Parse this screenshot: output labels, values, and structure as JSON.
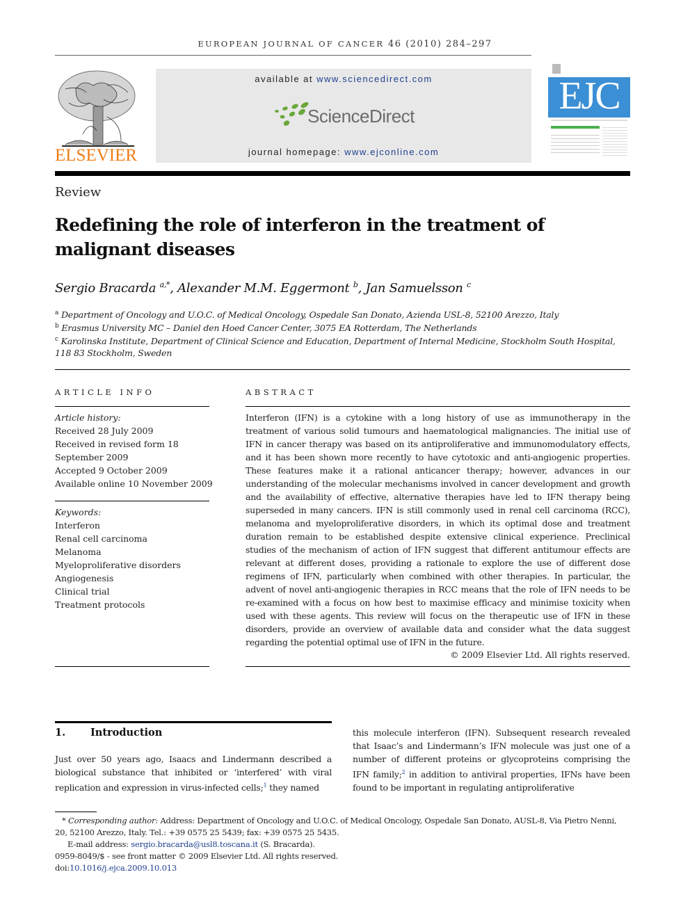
{
  "header": {
    "journal_name": "EUROPEAN JOURNAL OF CANCER",
    "volume_info": "46 (2010) 284–297",
    "publisher_wordmark": "ELSEVIER",
    "available_at_prefix": "available at ",
    "available_at_link": "www.sciencedirect.com",
    "sciencedirect_wordmark": "ScienceDirect",
    "homepage_prefix": "journal homepage: ",
    "homepage_link": "www.ejconline.com",
    "cover_title": "EJC",
    "colors": {
      "elsevier_orange": "#ef7d15",
      "sciencedirect_green": "#6aa83a",
      "ejc_blue": "#3b8fd4",
      "link_blue": "#1f3f8f"
    }
  },
  "article": {
    "section_type": "Review",
    "title": "Redefining the role of interferon in the treatment of malignant diseases",
    "authors": [
      {
        "name": "Sergio Bracarda",
        "sup": "a,*"
      },
      {
        "name": "Alexander M.M. Eggermont",
        "sup": "b"
      },
      {
        "name": "Jan Samuelsson",
        "sup": "c"
      }
    ],
    "affiliations": [
      {
        "key": "a",
        "text": "Department of Oncology and U.O.C. of Medical Oncology, Ospedale San Donato, Azienda USL-8, 52100 Arezzo, Italy"
      },
      {
        "key": "b",
        "text": "Erasmus University MC – Daniel den Hoed Cancer Center, 3075 EA Rotterdam, The Netherlands"
      },
      {
        "key": "c",
        "text": "Karolinska Institute, Department of Clinical Science and Education, Department of Internal Medicine, Stockholm South Hospital,",
        "text2": "118 83 Stockholm, Sweden"
      }
    ]
  },
  "article_info": {
    "heading": "ARTICLE INFO",
    "history_label": "Article history:",
    "history": [
      "Received 28 July 2009",
      "Received in revised form 18",
      "September 2009",
      "Accepted 9 October 2009",
      "Available online 10 November 2009"
    ],
    "keywords_label": "Keywords:",
    "keywords": [
      "Interferon",
      "Renal cell carcinoma",
      "Melanoma",
      "Myeloproliferative disorders",
      "Angiogenesis",
      "Clinical trial",
      "Treatment protocols"
    ]
  },
  "abstract": {
    "heading": "ABSTRACT",
    "text": "Interferon (IFN) is a cytokine with a long history of use as immunotherapy in the treatment of various solid tumours and haematological malignancies. The initial use of IFN in cancer therapy was based on its antiproliferative and immunomodulatory effects, and it has been shown more recently to have cytotoxic and anti-angiogenic properties. These features make it a rational anticancer therapy; however, advances in our understanding of the molecular mechanisms involved in cancer development and growth and the availability of effective, alternative therapies have led to IFN therapy being superseded in many cancers. IFN is still commonly used in renal cell carcinoma (RCC), melanoma and myeloproliferative disorders, in which its optimal dose and treatment duration remain to be established despite extensive clinical experience. Preclinical studies of the mechanism of action of IFN suggest that different antitumour effects are relevant at different doses, providing a rationale to explore the use of different dose regimens of IFN, particularly when combined with other therapies. In particular, the advent of novel anti-angiogenic therapies in RCC means that the role of IFN needs to be re-examined with a focus on how best to maximise efficacy and minimise toxicity when used with these agents. This review will focus on the therapeutic use of IFN in these disorders, provide an overview of available data and consider what the data suggest regarding the potential optimal use of IFN in the future.",
    "copyright": "© 2009 Elsevier Ltd. All rights reserved."
  },
  "introduction": {
    "number": "1.",
    "heading": "Introduction",
    "col1_a": "Just over 50 years ago, Isaacs and Lindermann described a biological substance that inhibited or ‘interfered’ with viral replication and expression in virus-infected cells;",
    "col1_ref": "1",
    "col1_b": " they named",
    "col2_a": "this molecule interferon (IFN). Subsequent research revealed that Isaac’s and Lindermann’s IFN molecule was just one of a number of different proteins or glycoproteins comprising the IFN family;",
    "col2_ref": "2",
    "col2_b": " in addition to antiviral properties, IFNs have been found to be important in regulating antiproliferative"
  },
  "footnotes": {
    "star": "*",
    "corresponding_label": "Corresponding author:",
    "corresponding_text": " Address: Department of Oncology and U.O.C. of Medical Oncology, Ospedale San Donato, AUSL-8, Via Pietro Nenni, 20, 52100 Arezzo, Italy. Tel.: +39 0575 25 5439; fax: +39 0575 25 5435.",
    "email_label": "E-mail address: ",
    "email": "sergio.bracarda@usl8.toscana.it",
    "email_suffix": " (S. Bracarda).",
    "issn_line": "0959-8049/$ - see front matter © 2009 Elsevier Ltd. All rights reserved.",
    "doi_label": "doi:",
    "doi": "10.1016/j.ejca.2009.10.013"
  }
}
